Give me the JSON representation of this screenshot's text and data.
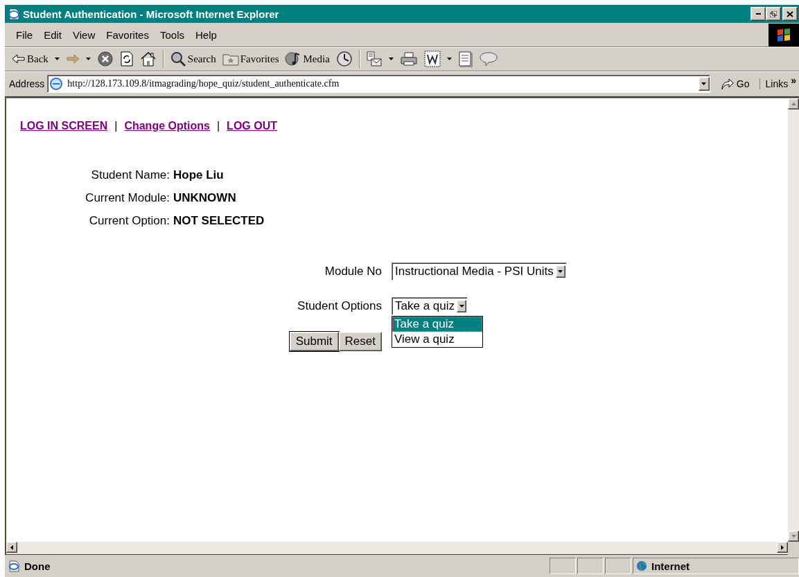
{
  "window": {
    "title": "Student Authentication - Microsoft Internet Explorer"
  },
  "menu": [
    {
      "label": "File"
    },
    {
      "label": "Edit"
    },
    {
      "label": "View"
    },
    {
      "label": "Favorites"
    },
    {
      "label": "Tools"
    },
    {
      "label": "Help"
    }
  ],
  "toolbar": [
    {
      "kind": "back",
      "label": "Back",
      "menu": true
    },
    {
      "kind": "forward",
      "menu": true
    },
    {
      "kind": "stop",
      "menu": false
    },
    {
      "kind": "refresh",
      "menu": false
    },
    {
      "kind": "home",
      "menu": false
    },
    {
      "kind": "separator"
    },
    {
      "kind": "search",
      "label": "Search",
      "menu": false
    },
    {
      "kind": "favorites",
      "label": "Favorites",
      "menu": false
    },
    {
      "kind": "media",
      "label": "Media",
      "menu": false
    },
    {
      "kind": "history",
      "menu": false
    },
    {
      "kind": "separator"
    },
    {
      "kind": "mail",
      "menu": true
    },
    {
      "kind": "print",
      "menu": false
    },
    {
      "kind": "edit",
      "menu": true
    },
    {
      "kind": "discuss",
      "menu": false
    },
    {
      "kind": "messenger",
      "menu": false
    }
  ],
  "address": {
    "label": "Address",
    "url": "http://128.173.109.8/itmagrading/hope_quiz/student_authenticate.cfm",
    "go": "Go",
    "links": "Links",
    "chevron": "»"
  },
  "nav": [
    {
      "kind": "link",
      "text": "LOG IN SCREEN"
    },
    {
      "kind": "separator",
      "text": "|"
    },
    {
      "kind": "link",
      "text": "Change Options"
    },
    {
      "kind": "separator",
      "text": "|"
    },
    {
      "kind": "link",
      "text": "LOG OUT"
    }
  ],
  "info": [
    {
      "label": "Student Name:",
      "value": "Hope Liu"
    },
    {
      "label": "Current Module:",
      "value": "UNKNOWN"
    },
    {
      "label": "Current Option:",
      "value": "NOT SELECTED"
    }
  ],
  "form": {
    "fields": [
      {
        "label": "Module No",
        "value": "Instructional Media - PSI Units"
      },
      {
        "label": "Student Options",
        "value": "Take a quiz",
        "options": [
          {
            "text": "Take a quiz",
            "selected": true
          },
          {
            "text": "View a quiz",
            "selected": false
          }
        ]
      }
    ],
    "buttons": [
      {
        "label": "Submit",
        "default": true
      },
      {
        "label": "Reset",
        "default": false
      }
    ]
  },
  "status_bar": {
    "text": "Done",
    "zone": "Internet"
  }
}
